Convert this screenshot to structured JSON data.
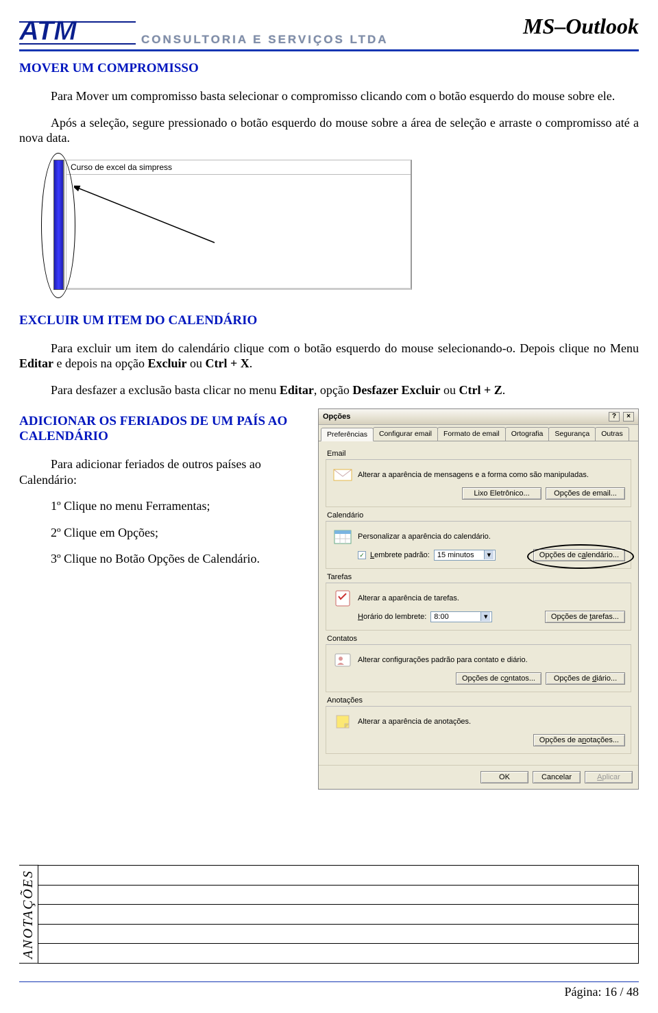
{
  "header": {
    "logo_subtitle": "CONSULTORIA E SERVIÇOS LTDA",
    "title": "MS–Outlook"
  },
  "section1": {
    "heading": "MOVER UM COMPROMISSO",
    "para1": "Para Mover um compromisso basta selecionar o compromisso clicando com o botão esquerdo do mouse sobre ele.",
    "para2": "Após a seleção, segure pressionado o botão esquerdo do mouse sobre a área de seleção e arraste o compromisso até a nova data."
  },
  "figure1": {
    "event_text": "Curso de excel da simpress"
  },
  "section2": {
    "heading": "EXCLUIR UM ITEM DO CALENDÁRIO",
    "para_a": "Para excluir um item do calendário clique com o botão esquerdo do mouse selecionando-o. Depois clique no Menu ",
    "bold1": "Editar",
    "para_b": " e depois na opção ",
    "bold2": "Excluir",
    "para_c": " ou ",
    "bold3": "Ctrl + X",
    "para_d": ".",
    "para2_a": "Para desfazer a exclusão basta clicar no menu ",
    "bold4": "Editar",
    "para2_b": ", opção ",
    "bold5": "Desfazer Excluir",
    "para2_c": " ou ",
    "bold6": "Ctrl + Z",
    "para2_d": "."
  },
  "section3": {
    "heading": "ADICIONAR OS FERIADOS DE UM PAÍS AO CALENDÁRIO",
    "para1": "Para adicionar feriados de outros países ao Calendário:",
    "step1": "1º Clique no menu Ferramentas;",
    "step2": "2º Clique em Opções;",
    "step3": "3º Clique no Botão Opções de Calendário."
  },
  "dialog": {
    "title": "Opções",
    "tabs": [
      "Preferências",
      "Configurar email",
      "Formato de email",
      "Ortografia",
      "Segurança",
      "Outras"
    ],
    "email": {
      "section": "Email",
      "desc": "Alterar a aparência de mensagens e a forma como são manipuladas.",
      "btn_junk": "Lixo Eletrônico...",
      "btn_opts": "Opções de email..."
    },
    "calendar": {
      "section": "Calendário",
      "desc": "Personalizar a aparência do calendário.",
      "checkbox_label": "Lembrete padrão:",
      "select_value": "15 minutos",
      "btn": "Opções de calendário..."
    },
    "tasks": {
      "section": "Tarefas",
      "desc": "Alterar a aparência de tarefas.",
      "label": "Horário do lembrete:",
      "select_value": "8:00",
      "btn": "Opções de tarefas..."
    },
    "contacts": {
      "section": "Contatos",
      "desc": "Alterar configurações padrão para contato e diário.",
      "btn1": "Opções de contatos...",
      "btn2": "Opções de diário..."
    },
    "notes": {
      "section": "Anotações",
      "desc": "Alterar a aparência de anotações.",
      "btn": "Opções de anotações..."
    },
    "footer": {
      "ok": "OK",
      "cancel": "Cancelar",
      "apply": "Aplicar"
    }
  },
  "anotacoes_label": "ANOTAÇÕES",
  "footer_page": "Página: 16 / 48"
}
